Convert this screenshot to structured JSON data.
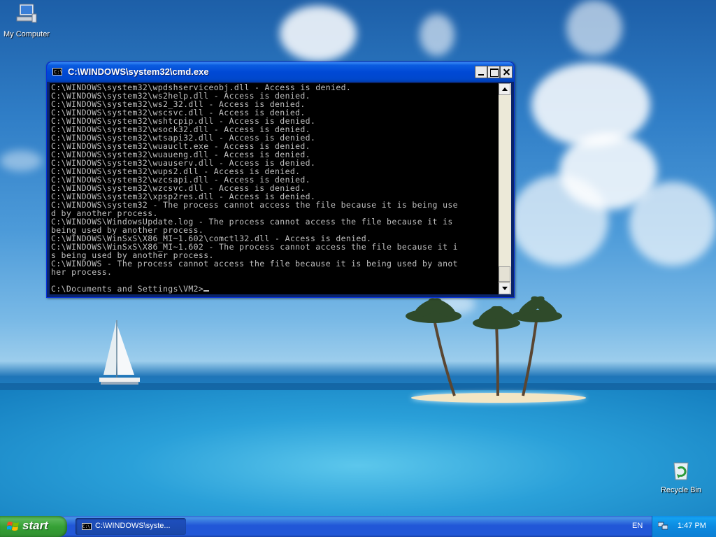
{
  "desktop": {
    "icons": [
      {
        "label": "My Computer"
      },
      {
        "label": "Recycle Bin"
      }
    ]
  },
  "window": {
    "title": "C:\\WINDOWS\\system32\\cmd.exe",
    "title_icon_text": "C:\\",
    "console_lines": [
      "C:\\WINDOWS\\system32\\wpdshserviceobj.dll - Access is denied.",
      "C:\\WINDOWS\\system32\\ws2help.dll - Access is denied.",
      "C:\\WINDOWS\\system32\\ws2_32.dll - Access is denied.",
      "C:\\WINDOWS\\system32\\wscsvc.dll - Access is denied.",
      "C:\\WINDOWS\\system32\\wshtcpip.dll - Access is denied.",
      "C:\\WINDOWS\\system32\\wsock32.dll - Access is denied.",
      "C:\\WINDOWS\\system32\\wtsapi32.dll - Access is denied.",
      "C:\\WINDOWS\\system32\\wuauclt.exe - Access is denied.",
      "C:\\WINDOWS\\system32\\wuaueng.dll - Access is denied.",
      "C:\\WINDOWS\\system32\\wuauserv.dll - Access is denied.",
      "C:\\WINDOWS\\system32\\wups2.dll - Access is denied.",
      "C:\\WINDOWS\\system32\\wzcsapi.dll - Access is denied.",
      "C:\\WINDOWS\\system32\\wzcsvc.dll - Access is denied.",
      "C:\\WINDOWS\\system32\\xpsp2res.dll - Access is denied.",
      "C:\\WINDOWS\\system32 - The process cannot access the file because it is being use",
      "d by another process.",
      "C:\\WINDOWS\\WindowsUpdate.log - The process cannot access the file because it is",
      "being used by another process.",
      "C:\\WINDOWS\\WinSxS\\X86_MI~1.602\\comctl32.dll - Access is denied.",
      "C:\\WINDOWS\\WinSxS\\X86_MI~1.602 - The process cannot access the file because it i",
      "s being used by another process.",
      "C:\\WINDOWS - The process cannot access the file because it is being used by anot",
      "her process.",
      "",
      "C:\\Documents and Settings\\VM2>"
    ]
  },
  "taskbar": {
    "start_label": "start",
    "task_item_label": "C:\\WINDOWS\\syste...",
    "task_icon_text": "C:\\",
    "language": "EN",
    "clock": "1:47 PM"
  }
}
